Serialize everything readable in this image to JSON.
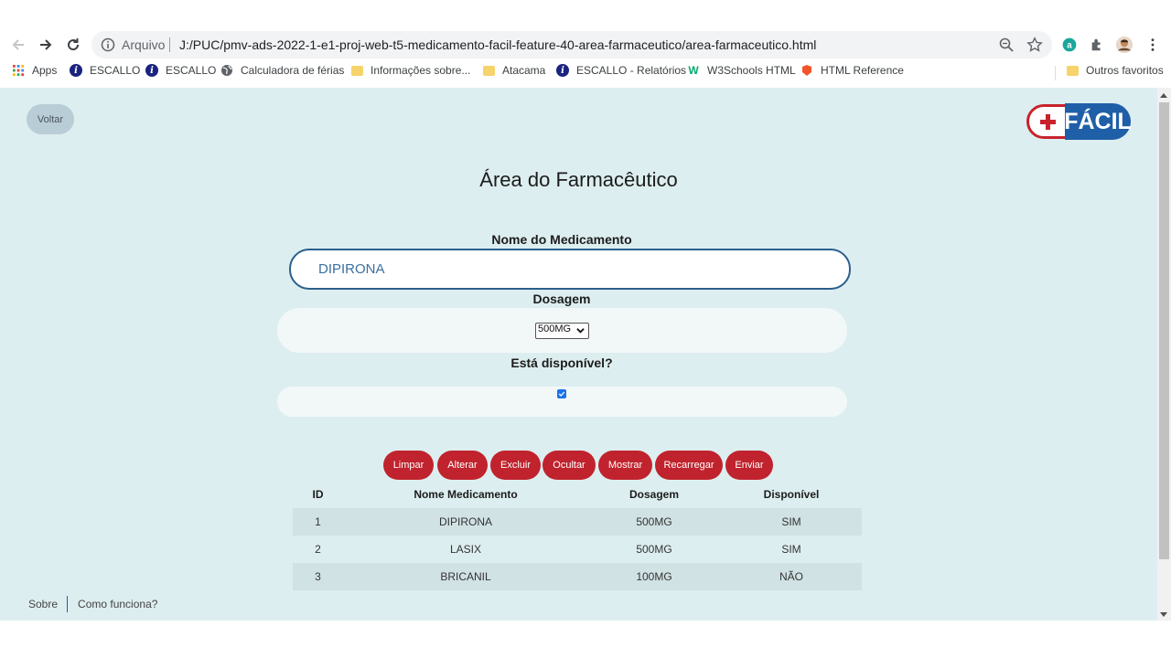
{
  "browser": {
    "omnibox": {
      "security_label": "Arquivo",
      "url": "J:/PUC/pmv-ads-2022-1-e1-proj-web-t5-medicamento-facil-feature-40-area-farmaceutico/area-farmaceutico.html"
    },
    "bookmarks": [
      {
        "label": "Apps",
        "icon": "apps-grid-icon"
      },
      {
        "label": "ESCALLO",
        "icon": "info-icon"
      },
      {
        "label": "ESCALLO",
        "icon": "info-icon"
      },
      {
        "label": "Calculadora de férias",
        "icon": "globe-icon"
      },
      {
        "label": "Informações sobre...",
        "icon": "folder-icon"
      },
      {
        "label": "Atacama",
        "icon": "folder-icon"
      },
      {
        "label": "ESCALLO - Relatórios",
        "icon": "info-icon"
      },
      {
        "label": "W3Schools HTML",
        "icon": "w3schools-icon"
      },
      {
        "label": "HTML Reference",
        "icon": "html-reference-icon"
      }
    ],
    "other_bookmarks": "Outros favoritos"
  },
  "page": {
    "back_button": "Voltar",
    "logo_text": "FÁCIL",
    "title": "Área do Farmacêutico",
    "form": {
      "name_label": "Nome do Medicamento",
      "name_value": "DIPIRONA",
      "dose_label": "Dosagem",
      "dose_selected": "500MG",
      "available_label": "Está disponível?",
      "available_checked": true
    },
    "buttons": [
      "Limpar",
      "Alterar",
      "Excluir",
      "Ocultar",
      "Mostrar",
      "Recarregar",
      "Enviar"
    ],
    "table": {
      "headers": [
        "ID",
        "Nome Medicamento",
        "Dosagem",
        "Disponível"
      ],
      "rows": [
        [
          "1",
          "DIPIRONA",
          "500MG",
          "SIM"
        ],
        [
          "2",
          "LASIX",
          "500MG",
          "SIM"
        ],
        [
          "3",
          "BRICANIL",
          "100MG",
          "NÃO"
        ]
      ]
    },
    "footer": {
      "about": "Sobre",
      "how_it_works": "Como funciona?"
    }
  },
  "colors": {
    "page_background": "#ddeef0",
    "button_red": "#c0232d",
    "logo_blue": "#1f5fa8",
    "input_border": "#2b5f8c"
  }
}
